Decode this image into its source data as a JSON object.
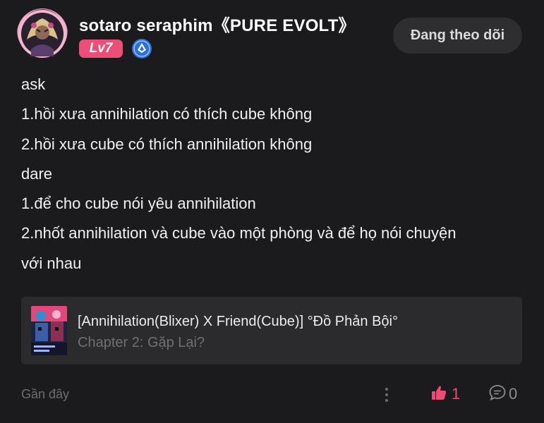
{
  "header": {
    "username": "sotaro seraphim《PURE EVOLT》",
    "level": "Lv7",
    "follow_label": "Đang theo dõi"
  },
  "post": {
    "lines": [
      "ask",
      "1.hồi xưa annihilation có thích cube không",
      "2.hồi xưa cube có thích annihilation không",
      "dare",
      "1.để cho cube nói yêu annihilation",
      "2.nhốt annihilation và cube vào một phòng và để họ nói chuyện",
      "với nhau"
    ]
  },
  "story": {
    "title": "[Annihilation(Blixer) X Friend(Cube)] °Đồ Phản Bội°",
    "chapter": "Chapter 2: Gặp Lại?"
  },
  "footer": {
    "timestamp": "Gần đây",
    "likes": "1",
    "comments": "0"
  },
  "colors": {
    "background": "#1b1b1d",
    "accent_pink": "#ee4d7a",
    "card": "#2b2b2e",
    "follow_button": "#2e2e31"
  },
  "icons": {
    "verified": "verified-shield-icon",
    "more": "more-vertical-icon",
    "like": "thumbs-up-icon",
    "comment": "comment-bubble-icon"
  }
}
